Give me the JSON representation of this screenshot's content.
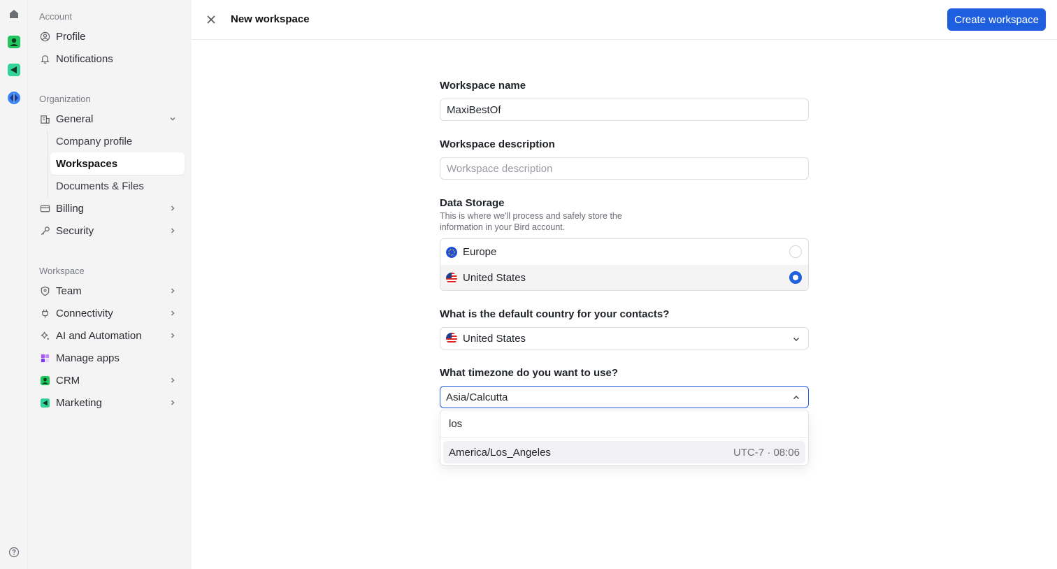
{
  "sidebar": {
    "account_label": "Account",
    "profile": "Profile",
    "notifications": "Notifications",
    "organization_label": "Organization",
    "general": "General",
    "general_sub": [
      "Company profile",
      "Workspaces",
      "Documents & Files"
    ],
    "billing": "Billing",
    "security": "Security",
    "workspace_label": "Workspace",
    "team": "Team",
    "connectivity": "Connectivity",
    "ai_automation": "AI and Automation",
    "manage_apps": "Manage apps",
    "crm": "CRM",
    "marketing": "Marketing"
  },
  "header": {
    "title": "New workspace",
    "create_label": "Create workspace"
  },
  "form": {
    "name_label": "Workspace name",
    "name_value": "MaxiBestOf",
    "desc_label": "Workspace description",
    "desc_placeholder": "Workspace description",
    "storage_label": "Data Storage",
    "storage_hint": "This is where we'll process and safely store the information in your Bird account.",
    "storage_options": [
      "Europe",
      "United States"
    ],
    "storage_selected": "United States",
    "country_label": "What is the default country for your contacts?",
    "country_value": "United States",
    "timezone_label": "What timezone do you want to use?",
    "timezone_value": "Asia/Calcutta",
    "timezone_search": "los",
    "timezone_results": [
      {
        "name": "America/Los_Angeles",
        "offset": "UTC-7",
        "time": "08:06"
      }
    ]
  },
  "colors": {
    "accent": "#1e5fe0",
    "sidebar_bg": "#f4f4f5"
  }
}
